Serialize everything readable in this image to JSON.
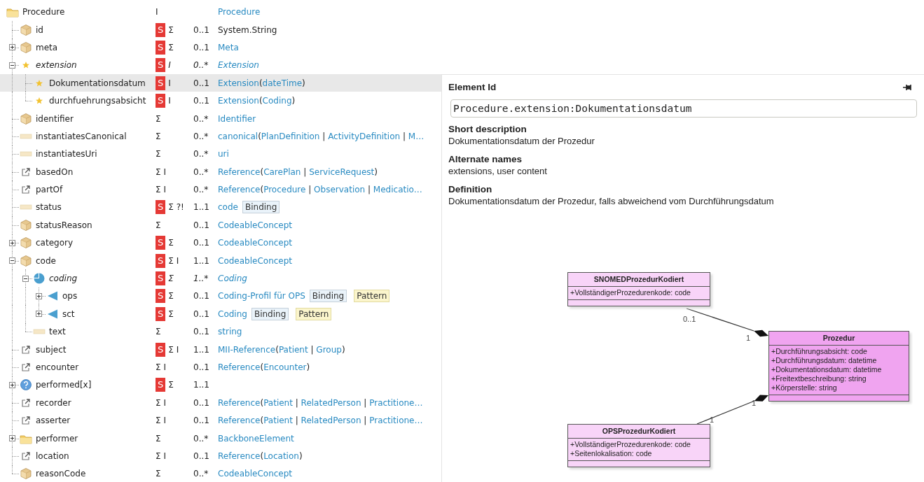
{
  "tree": {
    "name": "Procedure",
    "kind": "folder",
    "italic": false,
    "selected": false,
    "flags": [
      {
        "text": "I",
        "kind": "plain"
      }
    ],
    "type": [
      {
        "text": "Procedure",
        "link": true
      }
    ],
    "children": [
      {
        "name": "id",
        "kind": "cube",
        "italic": false,
        "selected": false,
        "flags": [
          {
            "text": "S",
            "kind": "badge"
          },
          {
            "text": "Σ",
            "kind": "plain"
          }
        ],
        "card": "0..1",
        "type": [
          {
            "text": "System.String",
            "link": false
          }
        ]
      },
      {
        "name": "meta",
        "kind": "cube",
        "italic": false,
        "selected": false,
        "expanded": false,
        "flags": [
          {
            "text": "S",
            "kind": "badge"
          },
          {
            "text": "Σ",
            "kind": "plain"
          }
        ],
        "card": "0..1",
        "type": [
          {
            "text": "Meta",
            "link": true
          }
        ]
      },
      {
        "name": "extension",
        "kind": "star",
        "italic": true,
        "selected": false,
        "expanded": true,
        "flags": [
          {
            "text": "S",
            "kind": "badge"
          },
          {
            "text": "I",
            "kind": "plain"
          }
        ],
        "card": "0..*",
        "type": [
          {
            "text": "Extension",
            "link": true
          }
        ],
        "children": [
          {
            "name": "Dokumentationsdatum",
            "kind": "star",
            "italic": false,
            "selected": true,
            "flags": [
              {
                "text": "S",
                "kind": "badge"
              },
              {
                "text": "I",
                "kind": "plain"
              }
            ],
            "card": "0..1",
            "type": [
              {
                "text": "Extension",
                "link": true
              },
              {
                "text": "(",
                "link": false
              },
              {
                "text": "dateTime",
                "link": true
              },
              {
                "text": ")",
                "link": false
              }
            ]
          },
          {
            "name": "durchfuehrungsabsicht",
            "kind": "star",
            "italic": false,
            "selected": false,
            "flags": [
              {
                "text": "S",
                "kind": "badge"
              },
              {
                "text": "I",
                "kind": "plain"
              }
            ],
            "card": "0..1",
            "type": [
              {
                "text": "Extension",
                "link": true
              },
              {
                "text": "(",
                "link": false
              },
              {
                "text": "Coding",
                "link": true
              },
              {
                "text": ")",
                "link": false
              }
            ]
          }
        ]
      },
      {
        "name": "identifier",
        "kind": "cube",
        "italic": false,
        "selected": false,
        "flags": [
          {
            "text": "Σ",
            "kind": "plain"
          }
        ],
        "card": "0..*",
        "type": [
          {
            "text": "Identifier",
            "link": true
          }
        ]
      },
      {
        "name": "instantiatesCanonical",
        "kind": "primitive",
        "italic": false,
        "selected": false,
        "flags": [
          {
            "text": "Σ",
            "kind": "plain"
          }
        ],
        "card": "0..*",
        "type": [
          {
            "text": "canonical",
            "link": true
          },
          {
            "text": "(",
            "link": false
          },
          {
            "text": "PlanDefinition",
            "link": true
          },
          {
            "text": " | ",
            "link": false
          },
          {
            "text": "ActivityDefinition",
            "link": true
          },
          {
            "text": " | ",
            "link": false
          },
          {
            "text": "M…",
            "link": true
          }
        ]
      },
      {
        "name": "instantiatesUri",
        "kind": "primitive",
        "italic": false,
        "selected": false,
        "flags": [
          {
            "text": "Σ",
            "kind": "plain"
          }
        ],
        "card": "0..*",
        "type": [
          {
            "text": "uri",
            "link": true
          }
        ]
      },
      {
        "name": "basedOn",
        "kind": "reference",
        "italic": false,
        "selected": false,
        "flags": [
          {
            "text": "Σ I",
            "kind": "plain"
          }
        ],
        "card": "0..*",
        "type": [
          {
            "text": "Reference",
            "link": true
          },
          {
            "text": "(",
            "link": false
          },
          {
            "text": "CarePlan",
            "link": true
          },
          {
            "text": " | ",
            "link": false
          },
          {
            "text": "ServiceRequest",
            "link": true
          },
          {
            "text": ")",
            "link": false
          }
        ]
      },
      {
        "name": "partOf",
        "kind": "reference",
        "italic": false,
        "selected": false,
        "flags": [
          {
            "text": "Σ I",
            "kind": "plain"
          }
        ],
        "card": "0..*",
        "type": [
          {
            "text": "Reference",
            "link": true
          },
          {
            "text": "(",
            "link": false
          },
          {
            "text": "Procedure",
            "link": true
          },
          {
            "text": " | ",
            "link": false
          },
          {
            "text": "Observation",
            "link": true
          },
          {
            "text": " | ",
            "link": false
          },
          {
            "text": "Medicatio…",
            "link": true
          }
        ]
      },
      {
        "name": "status",
        "kind": "primitive",
        "italic": false,
        "selected": false,
        "flags": [
          {
            "text": "S",
            "kind": "badge"
          },
          {
            "text": "Σ ?!",
            "kind": "plain"
          }
        ],
        "card": "1..1",
        "type": [
          {
            "text": "code",
            "link": true
          }
        ],
        "tags": [
          {
            "text": "Binding",
            "kind": "binding"
          }
        ]
      },
      {
        "name": "statusReason",
        "kind": "cube",
        "italic": false,
        "selected": false,
        "flags": [
          {
            "text": "Σ",
            "kind": "plain"
          }
        ],
        "card": "0..1",
        "type": [
          {
            "text": "CodeableConcept",
            "link": true
          }
        ]
      },
      {
        "name": "category",
        "kind": "cube",
        "italic": false,
        "selected": false,
        "expanded": false,
        "flags": [
          {
            "text": "S",
            "kind": "badge"
          },
          {
            "text": "Σ",
            "kind": "plain"
          }
        ],
        "card": "0..1",
        "type": [
          {
            "text": "CodeableConcept",
            "link": true
          }
        ]
      },
      {
        "name": "code",
        "kind": "cube",
        "italic": false,
        "selected": false,
        "expanded": true,
        "flags": [
          {
            "text": "S",
            "kind": "badge"
          },
          {
            "text": "Σ I",
            "kind": "plain"
          }
        ],
        "card": "1..1",
        "type": [
          {
            "text": "CodeableConcept",
            "link": true
          }
        ],
        "children": [
          {
            "name": "coding",
            "kind": "slice",
            "italic": true,
            "selected": false,
            "expanded": true,
            "flags": [
              {
                "text": "S",
                "kind": "badge"
              },
              {
                "text": "Σ",
                "kind": "plain"
              }
            ],
            "card": "1..*",
            "type": [
              {
                "text": "Coding",
                "link": true
              }
            ],
            "children": [
              {
                "name": "ops",
                "kind": "slice-item",
                "italic": false,
                "selected": false,
                "expanded": false,
                "flags": [
                  {
                    "text": "S",
                    "kind": "badge"
                  },
                  {
                    "text": "Σ",
                    "kind": "plain"
                  }
                ],
                "card": "0..1",
                "type": [
                  {
                    "text": "Coding-Profil für OPS",
                    "link": true
                  }
                ],
                "tags": [
                  {
                    "text": "Binding",
                    "kind": "binding"
                  },
                  {
                    "text": "Pattern",
                    "kind": "pattern"
                  }
                ]
              },
              {
                "name": "sct",
                "kind": "slice-item",
                "italic": false,
                "selected": false,
                "expanded": false,
                "flags": [
                  {
                    "text": "S",
                    "kind": "badge"
                  },
                  {
                    "text": "Σ",
                    "kind": "plain"
                  }
                ],
                "card": "0..1",
                "type": [
                  {
                    "text": "Coding",
                    "link": true
                  }
                ],
                "tags": [
                  {
                    "text": "Binding",
                    "kind": "binding"
                  },
                  {
                    "text": "Pattern",
                    "kind": "pattern"
                  }
                ]
              }
            ]
          },
          {
            "name": "text",
            "kind": "primitive",
            "italic": false,
            "selected": false,
            "flags": [
              {
                "text": "Σ",
                "kind": "plain"
              }
            ],
            "card": "0..1",
            "type": [
              {
                "text": "string",
                "link": true
              }
            ]
          }
        ]
      },
      {
        "name": "subject",
        "kind": "reference",
        "italic": false,
        "selected": false,
        "flags": [
          {
            "text": "S",
            "kind": "badge"
          },
          {
            "text": "Σ I",
            "kind": "plain"
          }
        ],
        "card": "1..1",
        "type": [
          {
            "text": "MII-Reference",
            "link": true
          },
          {
            "text": "(",
            "link": false
          },
          {
            "text": "Patient",
            "link": true
          },
          {
            "text": " | ",
            "link": false
          },
          {
            "text": "Group",
            "link": true
          },
          {
            "text": ")",
            "link": false
          }
        ]
      },
      {
        "name": "encounter",
        "kind": "reference",
        "italic": false,
        "selected": false,
        "flags": [
          {
            "text": "Σ I",
            "kind": "plain"
          }
        ],
        "card": "0..1",
        "type": [
          {
            "text": "Reference",
            "link": true
          },
          {
            "text": "(",
            "link": false
          },
          {
            "text": "Encounter",
            "link": true
          },
          {
            "text": ")",
            "link": false
          }
        ]
      },
      {
        "name": "performed[x]",
        "kind": "choice",
        "italic": false,
        "selected": false,
        "expanded": false,
        "flags": [
          {
            "text": "S",
            "kind": "badge"
          },
          {
            "text": "Σ",
            "kind": "plain"
          }
        ],
        "card": "1..1"
      },
      {
        "name": "recorder",
        "kind": "reference",
        "italic": false,
        "selected": false,
        "flags": [
          {
            "text": "Σ I",
            "kind": "plain"
          }
        ],
        "card": "0..1",
        "type": [
          {
            "text": "Reference",
            "link": true
          },
          {
            "text": "(",
            "link": false
          },
          {
            "text": "Patient",
            "link": true
          },
          {
            "text": " | ",
            "link": false
          },
          {
            "text": "RelatedPerson",
            "link": true
          },
          {
            "text": " | ",
            "link": false
          },
          {
            "text": "Practitione…",
            "link": true
          }
        ]
      },
      {
        "name": "asserter",
        "kind": "reference",
        "italic": false,
        "selected": false,
        "flags": [
          {
            "text": "Σ I",
            "kind": "plain"
          }
        ],
        "card": "0..1",
        "type": [
          {
            "text": "Reference",
            "link": true
          },
          {
            "text": "(",
            "link": false
          },
          {
            "text": "Patient",
            "link": true
          },
          {
            "text": " | ",
            "link": false
          },
          {
            "text": "RelatedPerson",
            "link": true
          },
          {
            "text": " | ",
            "link": false
          },
          {
            "text": "Practitione…",
            "link": true
          }
        ]
      },
      {
        "name": "performer",
        "kind": "folder",
        "italic": false,
        "selected": false,
        "expanded": false,
        "flags": [
          {
            "text": "Σ",
            "kind": "plain"
          }
        ],
        "card": "0..*",
        "type": [
          {
            "text": "BackboneElement",
            "link": true
          }
        ]
      },
      {
        "name": "location",
        "kind": "reference",
        "italic": false,
        "selected": false,
        "flags": [
          {
            "text": "Σ I",
            "kind": "plain"
          }
        ],
        "card": "0..1",
        "type": [
          {
            "text": "Reference",
            "link": true
          },
          {
            "text": "(",
            "link": false
          },
          {
            "text": "Location",
            "link": true
          },
          {
            "text": ")",
            "link": false
          }
        ]
      },
      {
        "name": "reasonCode",
        "kind": "cube",
        "italic": false,
        "selected": false,
        "flags": [
          {
            "text": "Σ",
            "kind": "plain"
          }
        ],
        "card": "0..*",
        "type": [
          {
            "text": "CodeableConcept",
            "link": true
          }
        ]
      }
    ]
  },
  "details_panel": {
    "element_id_label": "Element Id",
    "element_id": "Procedure.extension:Dokumentationsdatum",
    "sections": [
      {
        "heading": "Short description",
        "text": "Dokumentationsdatum der Prozedur"
      },
      {
        "heading": "Alternate names",
        "text": "extensions, user content"
      },
      {
        "heading": "Definition",
        "text": "Dokumentationsdatum der Prozedur, falls abweichend vom Durchführungsdatum"
      }
    ],
    "diagram": {
      "classes": [
        {
          "name": "SNOMEDProzedurKodiert",
          "color": "#f8d4f8",
          "attributes": [
            "+VollständigerProzedurenkode: code"
          ]
        },
        {
          "name": "Prozedur",
          "color": "#f0a4f0",
          "attributes": [
            "+Durchführungsabsicht: code",
            "+Durchführungsdatum: datetime",
            "+Dokumentationsdatum: datetime",
            "+Freitextbeschreibung: string",
            "+Körperstelle: string"
          ]
        },
        {
          "name": "OPSProzedurKodiert",
          "color": "#f8d4f8",
          "attributes": [
            "+VollständigerProzedurenkode: code",
            "+Seitenlokalisation: code"
          ]
        }
      ],
      "associations": [
        {
          "source_multiplicity": "0..1",
          "target_multiplicity": "1"
        },
        {
          "source_multiplicity": "1",
          "target_multiplicity": "1"
        }
      ]
    }
  }
}
